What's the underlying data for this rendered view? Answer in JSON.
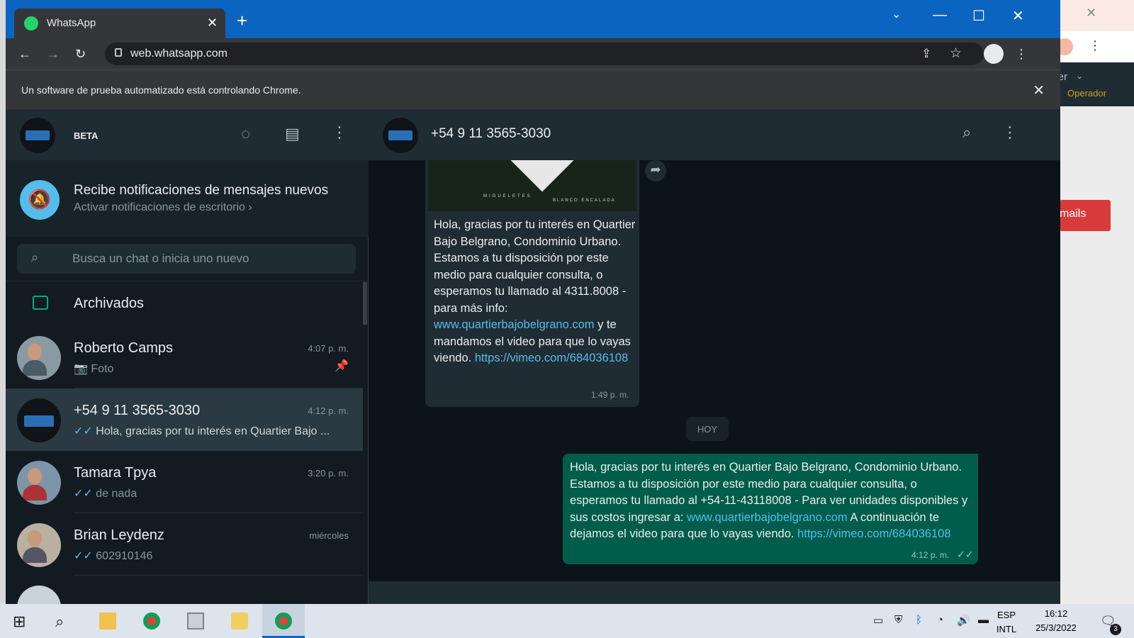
{
  "browser": {
    "tab_title": "WhatsApp",
    "url": "web.whatsapp.com",
    "infobar": "Un software de prueba automatizado está controlando Chrome."
  },
  "bg_window": {
    "user": "Javier",
    "role": "Operador",
    "button_fragment": "mails"
  },
  "left": {
    "label": "BETA",
    "notif_title": "Recibe notificaciones de mensajes nuevos",
    "notif_sub": "Activar notificaciones de escritorio",
    "search_placeholder": "Busca un chat o inicia uno nuevo",
    "archived": "Archivados",
    "chats": [
      {
        "name": "Roberto Camps",
        "time": "4:07 p. m.",
        "preview": "Foto"
      },
      {
        "name": "+54 9 11 3565-3030",
        "time": "4:12 p. m.",
        "preview": "Hola, gracias por tu interés en Quartier Bajo ..."
      },
      {
        "name": "Tamara Tpya",
        "time": "3:20 p. m.",
        "preview": "de nada"
      },
      {
        "name": "Brian Leydenz",
        "time": "miércoles",
        "preview": "602910146"
      }
    ]
  },
  "conversation": {
    "title": "+54 9 11 3565-3030",
    "image_labels": [
      "MIGUELETES",
      "BLANCO ENCALADA"
    ],
    "incoming": {
      "text": "Hola, gracias por tu interés en Quartier Bajo Belgrano, Condominio Urbano. Estamos a tu disposición por este medio para cualquier consulta, o esperamos tu llamado al 4311.8008  - para más info:",
      "link1": "www.quartierbajobelgrano.com",
      "text2": " y te mandamos el video para que lo vayas viendo.",
      "link2": "https://vimeo.com/684036108",
      "time": "1:49 p. m."
    },
    "day_chip": "HOY",
    "outgoing": {
      "text": "Hola, gracias por tu interés en Quartier Bajo Belgrano, Condominio Urbano. Estamos a tu disposición por este medio para cualquier consulta, o esperamos tu llamado al +54-11-43118008  - Para ver unidades disponibles y sus costos ingresar a:",
      "link1": "www.quartierbajobelgrano.com",
      "text2": " A continuación te dejamos el video para que lo vayas viendo. ",
      "link2": "https://vimeo.com/684036108",
      "time": "4:12 p. m."
    }
  },
  "taskbar": {
    "lang1": "ESP",
    "lang2": "INTL",
    "time": "16:12",
    "date": "25/3/2022",
    "notif_count": "3"
  }
}
